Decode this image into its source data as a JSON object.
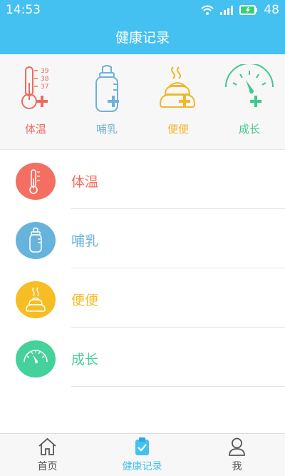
{
  "status": {
    "time": "14:53",
    "battery": "48"
  },
  "header": {
    "title": "健康记录"
  },
  "quick": [
    {
      "label": "体温",
      "icon": "thermometer-icon",
      "color": "#ef6a5e"
    },
    {
      "label": "哺乳",
      "icon": "baby-bottle-icon",
      "color": "#6fb2d7"
    },
    {
      "label": "便便",
      "icon": "poop-icon",
      "color": "#f1b72b"
    },
    {
      "label": "成长",
      "icon": "gauge-icon",
      "color": "#3ec88f"
    }
  ],
  "thermo_ticks": [
    "39",
    "38",
    "37"
  ],
  "list": [
    {
      "label": "体温",
      "icon": "thermometer-icon",
      "color": "#f36f61"
    },
    {
      "label": "哺乳",
      "icon": "baby-bottle-icon",
      "color": "#66b3db"
    },
    {
      "label": "便便",
      "icon": "poop-icon",
      "color": "#f6bd25"
    },
    {
      "label": "成长",
      "icon": "gauge-icon",
      "color": "#45d19a"
    }
  ],
  "tabs": [
    {
      "label": "首页",
      "icon": "home-icon",
      "active": false
    },
    {
      "label": "健康记录",
      "icon": "clipboard-check-icon",
      "active": true
    },
    {
      "label": "我",
      "icon": "user-icon",
      "active": false
    }
  ],
  "colors": {
    "header": "#44c1f1",
    "tab_active": "#44c1f1",
    "tab_inactive": "#555555"
  }
}
